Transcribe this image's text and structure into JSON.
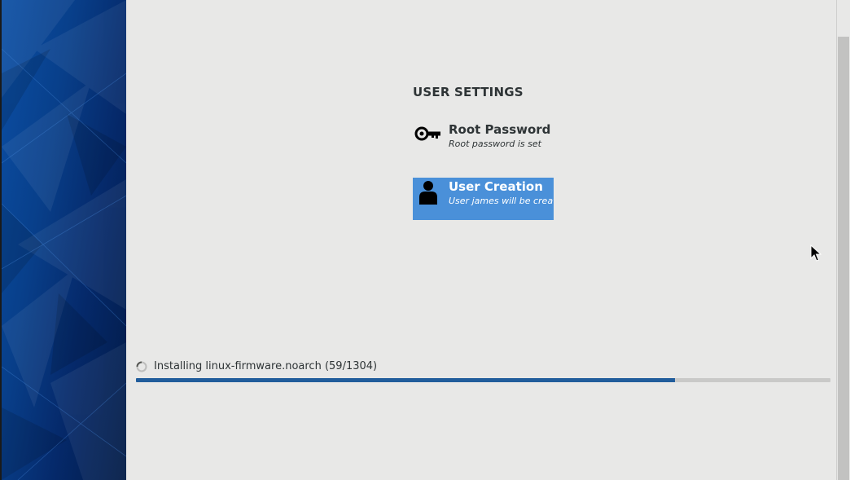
{
  "section": {
    "title": "USER SETTINGS"
  },
  "spokes": [
    {
      "title": "Root Password",
      "status": "Root password is set",
      "icon": "key-icon"
    },
    {
      "title": "User Creation",
      "status": "User james will be created",
      "icon": "user-icon",
      "selected": true
    }
  ],
  "progress": {
    "label": "Installing linux-firmware.noarch (59/1304)",
    "fraction": 0.776
  },
  "colors": {
    "background": "#e8e8e7",
    "selected_spoke": "#4a90d9",
    "progress_fill": "#215d9c",
    "sidebar_dark": "#021a45",
    "sidebar_light": "#0b4fa5"
  }
}
